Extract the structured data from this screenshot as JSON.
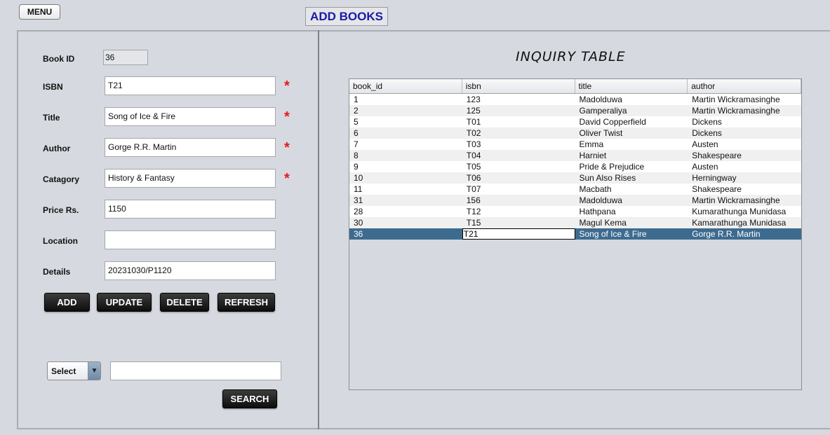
{
  "header": {
    "menu_label": "MENU",
    "title": "ADD BOOKS"
  },
  "form": {
    "book_id_label": "Book ID",
    "book_id_value": "36",
    "isbn_label": "ISBN",
    "isbn_value": "T21",
    "title_label": "Title",
    "title_value": "Song of Ice & Fire",
    "author_label": "Author",
    "author_value": "Gorge R.R. Martin",
    "category_label": "Catagory",
    "category_value": "History & Fantasy",
    "price_label": "Price Rs.",
    "price_value": "1150",
    "location_label": "Location",
    "location_value": "",
    "details_label": "Details",
    "details_value": "20231030/P1120",
    "required_mark": "*"
  },
  "buttons": {
    "add": "ADD",
    "update": "UPDATE",
    "delete": "DELETE",
    "refresh": "REFRESH",
    "search": "SEARCH"
  },
  "search": {
    "select_value": "Select",
    "select_arrow": "▼",
    "query": ""
  },
  "table": {
    "title": "INQUIRY TABLE",
    "columns": [
      "book_id",
      "isbn",
      "title",
      "author"
    ],
    "rows": [
      [
        "1",
        "123",
        "Madolduwa",
        "Martin Wickramasinghe"
      ],
      [
        "2",
        "125",
        "Gamperaliya",
        "Martin Wickramasinghe"
      ],
      [
        "5",
        "T01",
        "David Copperfield",
        "Dickens"
      ],
      [
        "6",
        "T02",
        "Oliver Twist",
        "Dickens"
      ],
      [
        "7",
        "T03",
        "Emma",
        "Austen"
      ],
      [
        "8",
        "T04",
        "Harniet",
        "Shakespeare"
      ],
      [
        "9",
        "T05",
        "Pride & Prejudice",
        "Austen"
      ],
      [
        "10",
        "T06",
        "Sun Also Rises",
        "Herningway"
      ],
      [
        "11",
        "T07",
        "Macbath",
        "Shakespeare"
      ],
      [
        "31",
        "156",
        "Madolduwa",
        "Martin Wickramasinghe"
      ],
      [
        "28",
        "T12",
        "Hathpana",
        "Kumarathunga Munidasa"
      ],
      [
        "30",
        "T15",
        "Magul Kema",
        "Kamarathunga Munidasa"
      ],
      [
        "36",
        "T21",
        "Song of Ice & Fire",
        "Gorge R.R. Martin"
      ]
    ],
    "selected_row": 12,
    "selection_color": "#3d6b8f"
  },
  "colors": {
    "background": "#d6d9df",
    "title_blue": "#1a1aa6",
    "required_red": "#e31b1b",
    "button_dark": "#1a1a1a"
  }
}
